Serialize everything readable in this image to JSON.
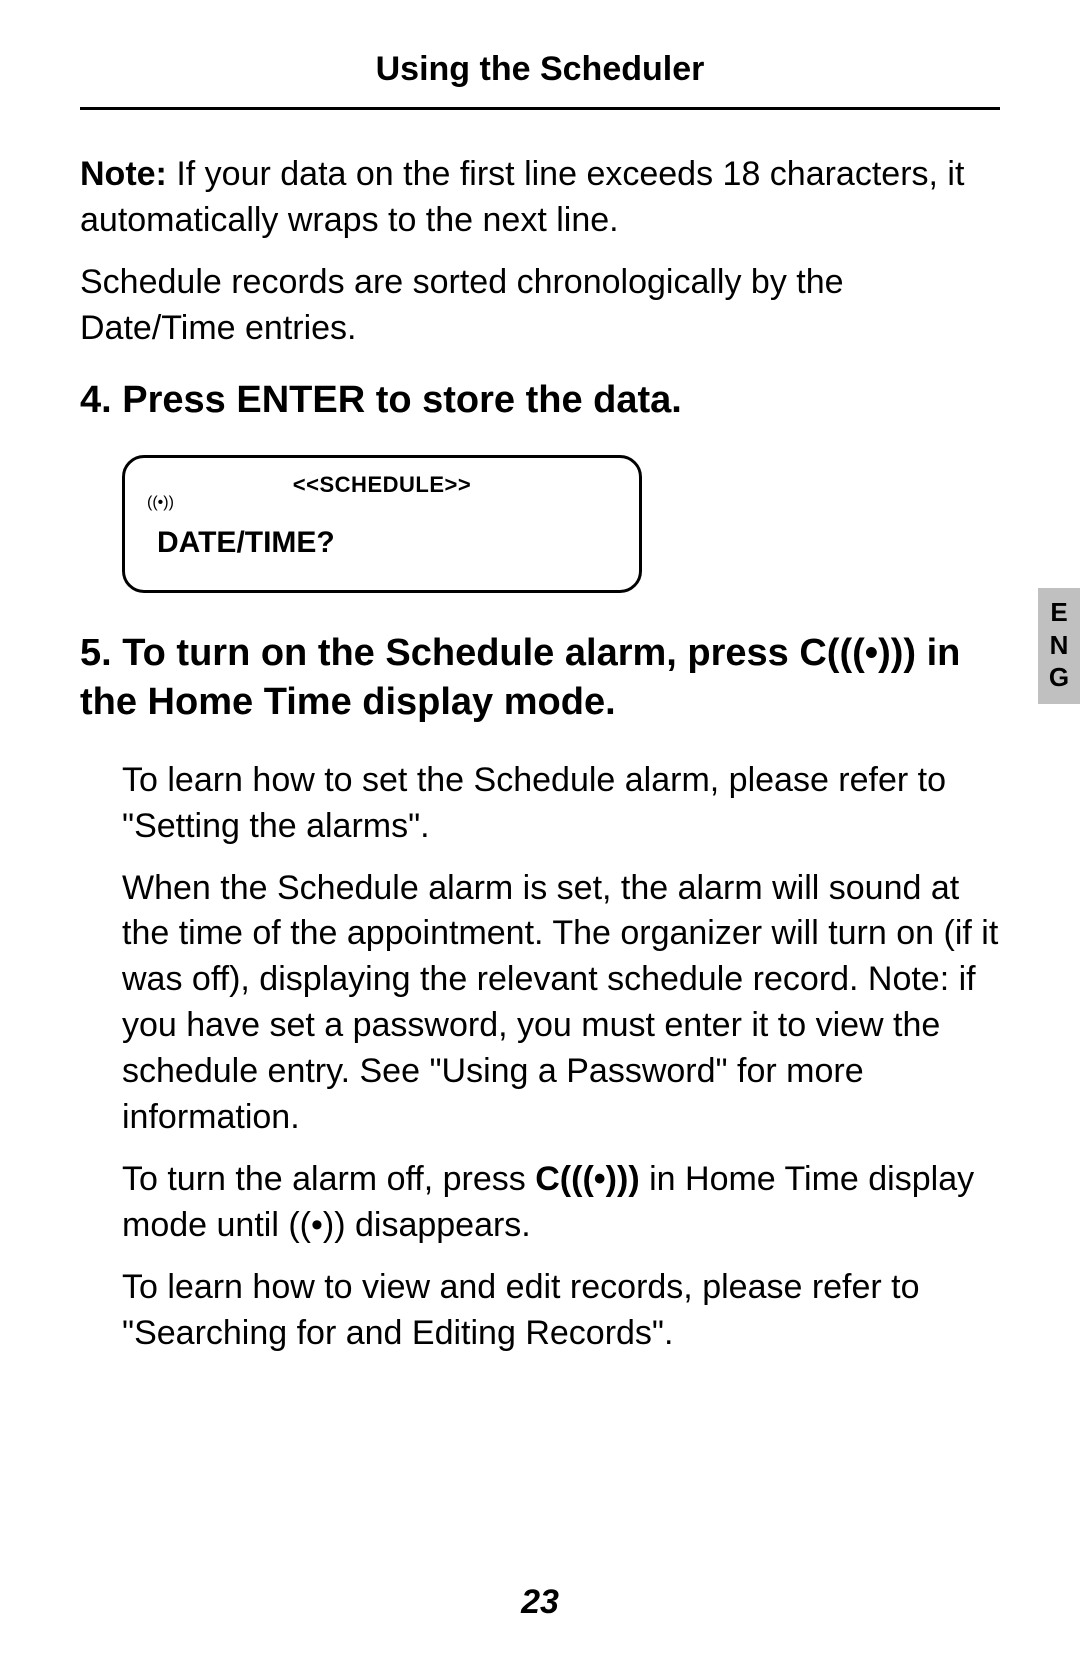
{
  "header": "Using the Scheduler",
  "note_prefix": "Note:",
  "note_text": " If your data on the first line exceeds 18 characters, it automatically wraps to the next line.",
  "para_sort": "Schedule records are sorted chronologically by the Date/Time entries.",
  "step4_heading": "4. Press ENTER to store the data.",
  "lcd": {
    "title": "<<SCHEDULE>>",
    "icon": "((•))",
    "prompt": "DATE/TIME?"
  },
  "step5_heading_a": "5. To turn on the Schedule alarm, press C(",
  "step5_heading_b": ") in the Home Time display mode.",
  "alarm_glyph": "((•))",
  "step5_body_1": "To learn how to set the Schedule alarm, please refer to \"Setting the alarms\".",
  "step5_body_2": "When the Schedule alarm is set, the alarm will sound at the time of the appointment. The organizer will turn on (if it was off), displaying the relevant schedule record. Note: if you have set a password, you must enter it to view the schedule entry. See \"Using a Password\" for more information.",
  "step5_body_3a": "To turn the alarm off, press ",
  "step5_body_3b": "C(",
  "step5_body_3c": ")",
  "step5_body_3d": " in Home Time display mode until ",
  "step5_body_3e": " disappears.",
  "step5_body_4": "To learn how to view and edit records, please refer to \"Searching for and Editing Records\".",
  "side_tab": {
    "l1": "E",
    "l2": "N",
    "l3": "G"
  },
  "page_number": "23"
}
